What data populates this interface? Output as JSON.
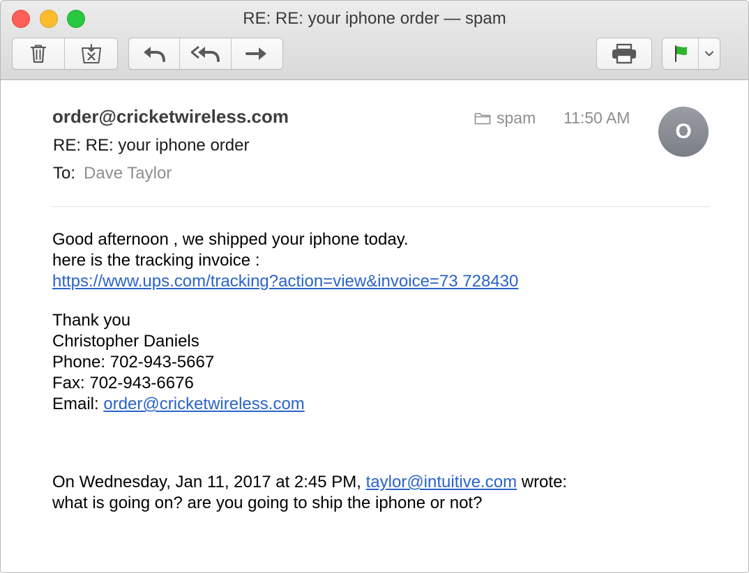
{
  "window": {
    "title": "RE: RE: your iphone order — spam"
  },
  "toolbar": {
    "buttons": [
      {
        "icon": "trash-icon"
      },
      {
        "icon": "junk-icon"
      },
      {
        "icon": "reply-icon"
      },
      {
        "icon": "reply-all-icon"
      },
      {
        "icon": "forward-icon"
      },
      {
        "icon": "printer-icon"
      },
      {
        "icon": "flag-icon"
      },
      {
        "icon": "chevron-down-icon"
      }
    ],
    "flag_color": "#2db52d"
  },
  "header": {
    "from": "order@cricketwireless.com",
    "subject": "RE: RE: your iphone order",
    "to_label": "To:",
    "to_name": "Dave Taylor",
    "mailbox": "spam",
    "time": "11:50 AM",
    "avatar_initial": "O"
  },
  "body": {
    "line1": "Good afternoon , we shipped your iphone today.",
    "line2": "here is the tracking invoice :",
    "tracking_link": "https://www.ups.com/tracking?action=view&invoice=73 728430",
    "signoff": "Thank you",
    "name": "Christopher Daniels",
    "phone": "Phone: 702-943-5667",
    "fax": "Fax: 702-943-6676",
    "email_label": "Email:",
    "email_link": "order@cricketwireless.com",
    "quote_prefix": "On Wednesday, Jan 11, 2017 at 2:45 PM,",
    "quote_link": "taylor@intuitive.com",
    "quote_suffix": "wrote:",
    "quote_text": "what is going on? are you going to ship the iphone or not?"
  },
  "colors": {
    "link": "#2a63c9",
    "muted_text": "#8e8e8e",
    "traffic_close": "#fc5f57",
    "traffic_minimize": "#fdbc2e",
    "traffic_maximize": "#29c840"
  }
}
